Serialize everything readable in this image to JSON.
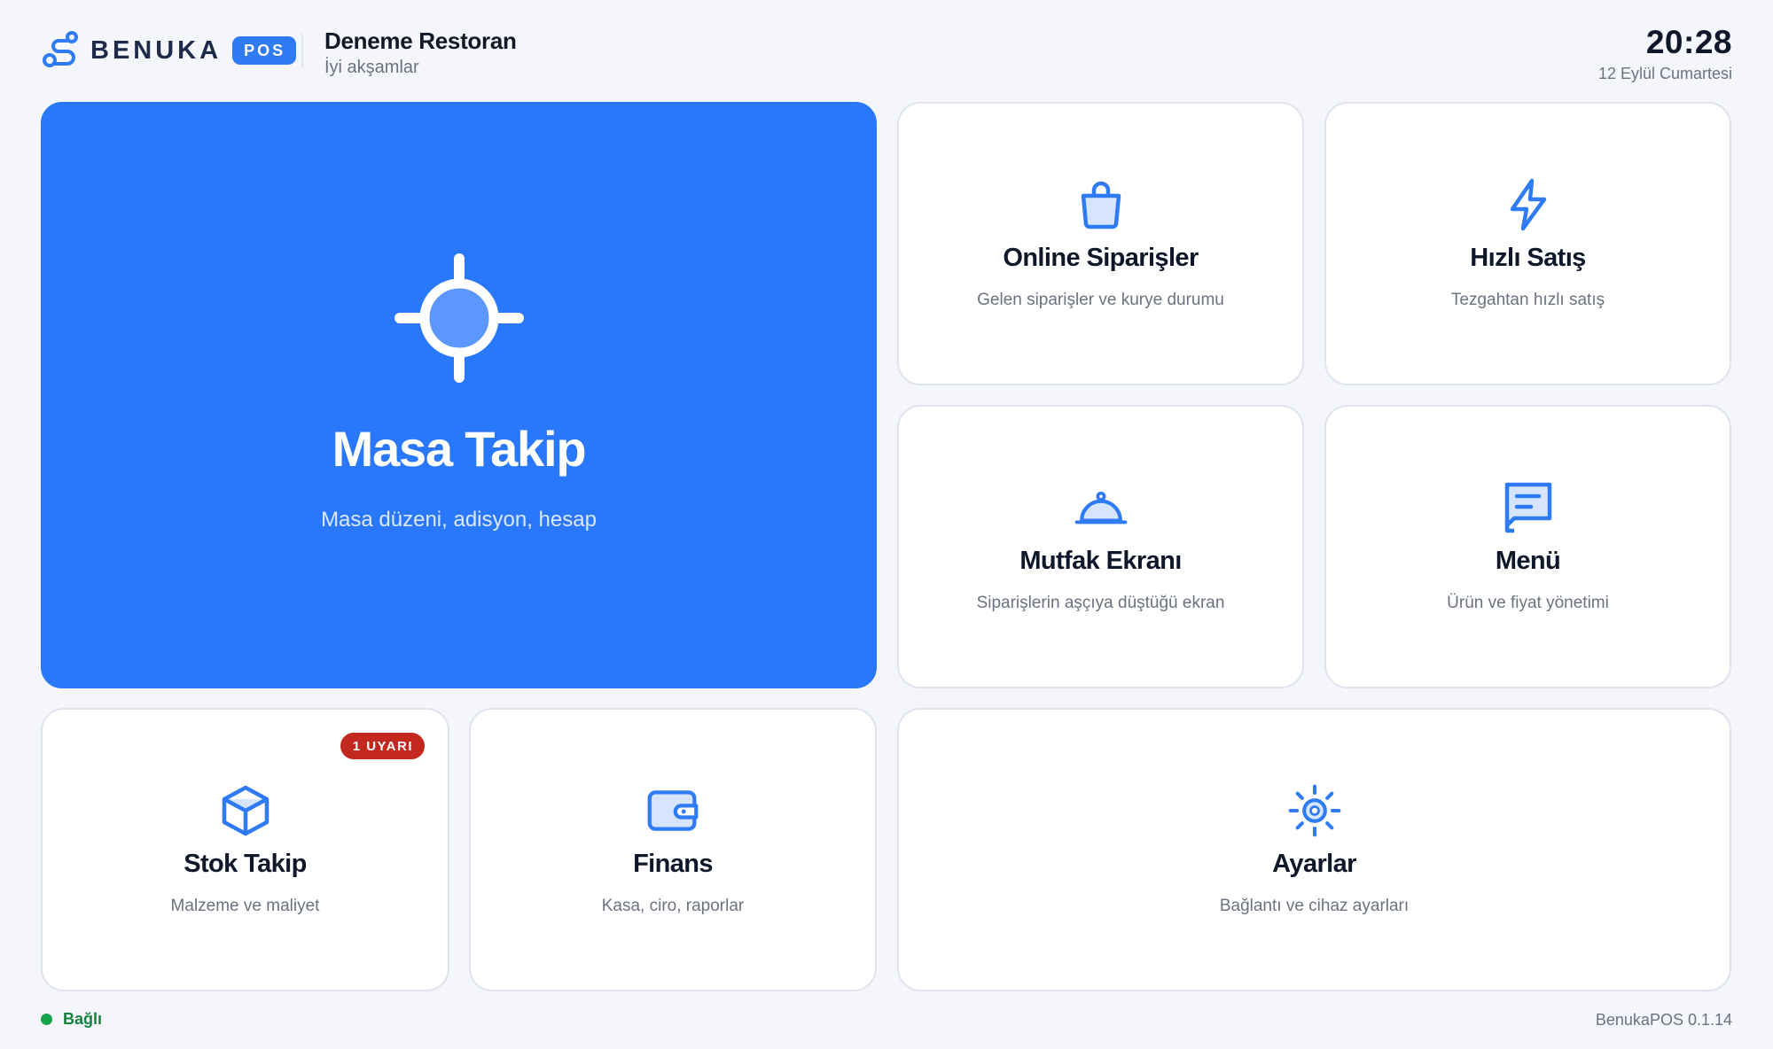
{
  "colors": {
    "accent": "#2977fb",
    "tile_border": "#dfe3ee",
    "badge_red": "#c3281f",
    "connected_green": "#16a34a"
  },
  "header": {
    "brand_name": "BENUKA",
    "brand_badge": "POS",
    "restaurant_name": "Deneme Restoran",
    "greeting": "İyi akşamlar",
    "time": "20:28",
    "date": "12 Eylül Cumartesi"
  },
  "tiles": {
    "masa_takip": {
      "title": "Masa Takip",
      "subtitle": "Masa düzeni, adisyon, hesap",
      "icon": "crosshair-icon"
    },
    "online_siparisler": {
      "title": "Online Siparişler",
      "subtitle": "Gelen siparişler ve kurye durumu",
      "icon": "shopping-bag-icon"
    },
    "hizli_satis": {
      "title": "Hızlı Satış",
      "subtitle": "Tezgahtan hızlı satış",
      "icon": "lightning-icon"
    },
    "mutfak_ekrani": {
      "title": "Mutfak Ekranı",
      "subtitle": "Siparişlerin aşçıya düştüğü ekran",
      "icon": "cloche-icon"
    },
    "menu": {
      "title": "Menü",
      "subtitle": "Ürün ve fiyat yönetimi",
      "icon": "document-icon"
    },
    "stok_takip": {
      "title": "Stok Takip",
      "subtitle": "Malzeme ve maliyet",
      "icon": "box-icon",
      "badge": "1 UYARI"
    },
    "finans": {
      "title": "Finans",
      "subtitle": "Kasa, ciro, raporlar",
      "icon": "wallet-icon"
    },
    "ayarlar": {
      "title": "Ayarlar",
      "subtitle": "Bağlantı ve cihaz ayarları",
      "icon": "sun-gear-icon"
    }
  },
  "footer": {
    "connection_status": "Bağlı",
    "version": "BenukaPOS 0.1.14"
  }
}
